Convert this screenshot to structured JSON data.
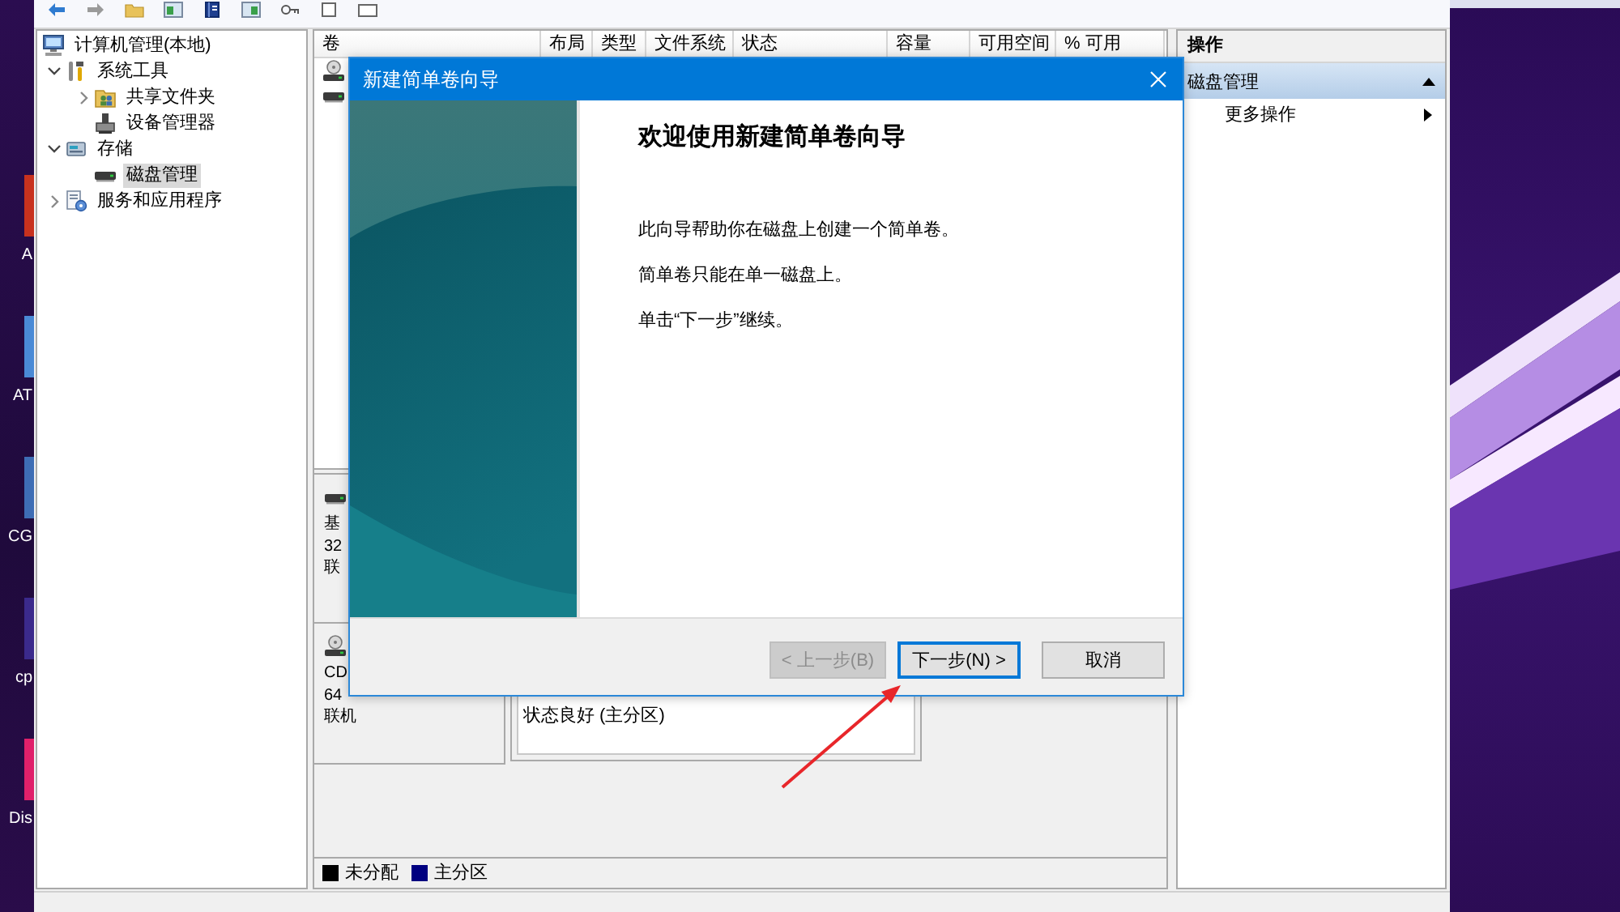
{
  "desktop_icons": [
    {
      "label": "A",
      "color": "#c8321e"
    },
    {
      "label": "AT",
      "color": "#4a8ad6"
    },
    {
      "label": "CG",
      "color": "#3e6db5"
    },
    {
      "label": "cp",
      "color": "#3b2a8c"
    },
    {
      "label": "Dis",
      "color": "#e0206a"
    }
  ],
  "tree": {
    "label": "计算机管理(本地)",
    "kind": "computer",
    "selected": false,
    "children": [
      {
        "label": "系统工具",
        "kind": "tools",
        "expanded": true,
        "selected": false,
        "children": [
          {
            "label": "共享文件夹",
            "kind": "folder",
            "expanded": false,
            "selected": false
          },
          {
            "label": "设备管理器",
            "kind": "device",
            "selected": false
          }
        ]
      },
      {
        "label": "存储",
        "kind": "storage",
        "expanded": true,
        "selected": false,
        "children": [
          {
            "label": "磁盘管理",
            "kind": "disk",
            "selected": true
          }
        ]
      },
      {
        "label": "服务和应用程序",
        "kind": "services",
        "expanded": false,
        "selected": false
      }
    ]
  },
  "volume_table": {
    "columns": [
      "卷",
      "布局",
      "类型",
      "文件系统",
      "状态",
      "容量",
      "可用空间",
      "% 可用"
    ],
    "rows": [
      {
        "kind": "optical"
      },
      {
        "kind": "disk"
      }
    ]
  },
  "disks": [
    {
      "kind": "disk",
      "lines": [
        "基",
        "32",
        "联"
      ]
    },
    {
      "kind": "optical",
      "lines": [
        "CD",
        "64",
        "联机"
      ],
      "partition": {
        "status": "状态良好 (主分区)"
      }
    }
  ],
  "legend": [
    {
      "label": "未分配",
      "color": "#000000"
    },
    {
      "label": "主分区",
      "color": "#000080"
    }
  ],
  "actions": {
    "title": "操作",
    "section": {
      "label": "磁盘管理",
      "expanded": true
    },
    "items": [
      {
        "label": "更多操作"
      }
    ]
  },
  "dialog": {
    "title": "新建简单卷向导",
    "heading": "欢迎使用新建简单卷向导",
    "paragraphs": [
      "此向导帮助你在磁盘上创建一个简单卷。",
      "简单卷只能在单一磁盘上。",
      "单击“下一步”继续。"
    ],
    "buttons": [
      {
        "kind": "back",
        "label": "< 上一步(B)",
        "disabled": true,
        "focused": false
      },
      {
        "kind": "next",
        "label": "下一步(N) >",
        "disabled": false,
        "focused": true
      },
      {
        "kind": "cancel",
        "label": "取消",
        "disabled": false,
        "focused": false
      }
    ]
  }
}
